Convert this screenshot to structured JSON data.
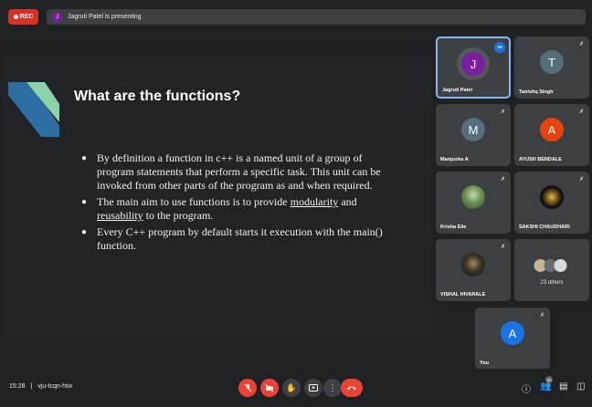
{
  "topbar": {
    "rec_label": "REC",
    "presenter_initial": "J",
    "presenting_text": "Jagruti Patel is presenting"
  },
  "slide": {
    "title": "What are the functions?",
    "bullets": [
      {
        "parts": [
          {
            "t": "By definition a function in c++ is a named unit of a group of program statements that perform a specific task. This unit can be invoked from other parts of the program as and when required.",
            "u": false
          }
        ]
      },
      {
        "parts": [
          {
            "t": "The main aim to use functions  is to provide ",
            "u": false
          },
          {
            "t": "modularity",
            "u": true
          },
          {
            "t": " and ",
            "u": false
          },
          {
            "t": "reusability",
            "u": true
          },
          {
            "t": " to the program.",
            "u": false
          }
        ]
      },
      {
        "parts": [
          {
            "t": "Every C++ program by default starts it execution with the main()  function.",
            "u": false
          }
        ]
      }
    ],
    "accent_colors": [
      "#2e6da4",
      "#8fd1a8"
    ]
  },
  "participants": [
    {
      "name": "Jagruti Patel",
      "initial": "J",
      "color": "#7b1fa2",
      "speaking": true
    },
    {
      "name": "Tanishq Singh",
      "initial": "T",
      "color": "#546e7a",
      "speaking": false
    },
    {
      "name": "Manjusha A",
      "initial": "M",
      "color": "#546e7a",
      "speaking": false
    },
    {
      "name": "AYUSH BENDALE",
      "initial": "A",
      "color": "#e8430e",
      "speaking": false
    },
    {
      "name": "Krisha Elle",
      "initial": "",
      "color": "#5a7a4a",
      "speaking": false
    },
    {
      "name": "SAKSHI CHAUDHARI",
      "initial": "",
      "color": "#1a1a1a",
      "speaking": false
    },
    {
      "name": "VISHAL HIVARALE",
      "initial": "",
      "color": "#2a2a2a",
      "speaking": false
    },
    {
      "name": "",
      "others_label": "23 others"
    },
    {
      "name": "You",
      "initial": "A",
      "color": "#1a73e8",
      "speaking": false
    }
  ],
  "bottombar": {
    "time": "15:28",
    "separator": "|",
    "meeting_code": "vju-tcqn-htw",
    "people_count": "32"
  },
  "icons": {
    "mic_off": "mic-off-icon",
    "cam_off": "camera-off-icon",
    "raise_hand": "raise-hand-icon",
    "present": "present-icon",
    "more": "more-options-icon",
    "end_call": "end-call-icon",
    "info": "info-icon",
    "people": "people-icon",
    "chat": "chat-icon",
    "activities": "activities-icon"
  }
}
